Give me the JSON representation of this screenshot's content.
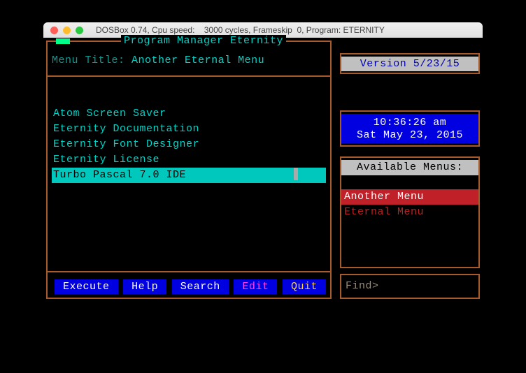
{
  "window": {
    "title": "DOSBox 0.74, Cpu speed:    3000 cycles, Frameskip  0, Program: ETERNITY"
  },
  "header": {
    "app_title": "Program Manager Eternity",
    "menu_title_label": "Menu Title:",
    "menu_title_value": "Another Eternal Menu"
  },
  "programs": [
    {
      "label": "Atom Screen Saver",
      "selected": false
    },
    {
      "label": "Eternity Documentation",
      "selected": false
    },
    {
      "label": "Eternity Font Designer",
      "selected": false
    },
    {
      "label": "Eternity License",
      "selected": false
    },
    {
      "label": "Turbo Pascal 7.0 IDE",
      "selected": true
    }
  ],
  "buttons": {
    "execute": "Execute",
    "help": "Help",
    "search": "Search",
    "edit": "Edit",
    "quit": "Quit"
  },
  "version": {
    "label": "Version 5/23/15"
  },
  "clock": {
    "time": "10:36:26 am",
    "date": "Sat May 23, 2015"
  },
  "available_menus": {
    "header": "Available Menus:",
    "items": [
      {
        "label": "Another Menu",
        "selected": true
      },
      {
        "label": "Eternal Menu",
        "selected": false
      }
    ]
  },
  "find": {
    "label": "Find>"
  }
}
